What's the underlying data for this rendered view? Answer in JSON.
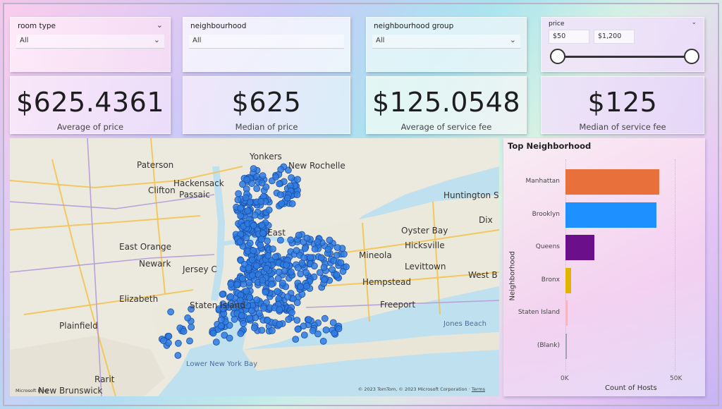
{
  "slicers": {
    "room_type": {
      "title": "room type",
      "value": "All"
    },
    "neighbourhood": {
      "title": "neighbourhood",
      "value": "All"
    },
    "neighbourhood_group": {
      "title": "neighbourhood group",
      "value": "All"
    },
    "price": {
      "title": "price",
      "min": "$50",
      "max": "$1,200"
    }
  },
  "kpis": [
    {
      "value": "$625.4361",
      "label": "Average of price"
    },
    {
      "value": "$625",
      "label": "Median of price"
    },
    {
      "value": "$125.0548",
      "label": "Average of service fee"
    },
    {
      "value": "$125",
      "label": "Median of service fee"
    }
  ],
  "map": {
    "labels": [
      "Yonkers",
      "Paterson",
      "Hackensack",
      "New Rochelle",
      "Clifton",
      "Passaic",
      "Huntington Station",
      "Oyster Bay",
      "East Orange",
      "Newark",
      "Jersey C",
      "Mineola",
      "Hicksville",
      "Levittown",
      "Dix",
      "West B",
      "Hempstead",
      "Elizabeth",
      "Freeport",
      "Plainfield",
      "Staten Island",
      "Lower New York Bay",
      "Jones Beach",
      "New Brunswick",
      "East",
      "Rarit"
    ],
    "attribution": "© 2023 TomTom, © 2023 Microsoft Corporation",
    "terms": "Terms",
    "logo": "Microsoft Bing"
  },
  "chart_data": {
    "type": "bar",
    "orientation": "horizontal",
    "title": "Top Neighborhood",
    "xlabel": "Count of Hosts",
    "ylabel": "Neighborhood",
    "categories": [
      "Manhattan",
      "Brooklyn",
      "Queens",
      "Bronx",
      "Staten Island",
      "(Blank)"
    ],
    "values": [
      43000,
      41500,
      13200,
      2700,
      1000,
      300
    ],
    "colors": [
      "#e8703a",
      "#1e90ff",
      "#6b0f8a",
      "#e1b400",
      "#f4b6c2",
      "#9aa5b1"
    ],
    "xticks": [
      "0K",
      "50K"
    ],
    "xlim": [
      0,
      50000
    ],
    "grid": true
  }
}
